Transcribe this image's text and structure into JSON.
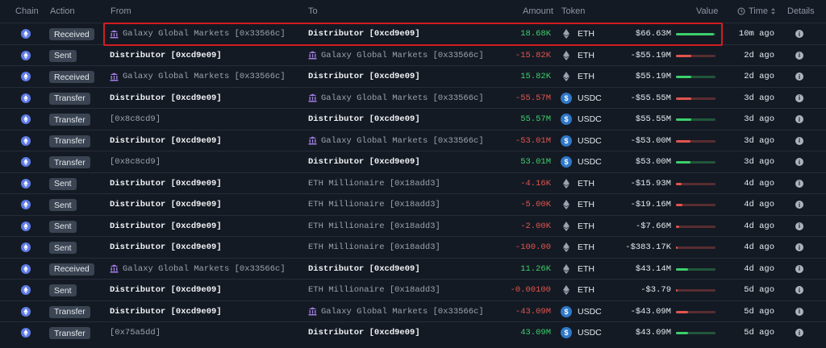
{
  "header": {
    "chain": "Chain",
    "action": "Action",
    "from": "From",
    "to": "To",
    "amount": "Amount",
    "token": "Token",
    "value": "Value",
    "time": "Time",
    "details": "Details"
  },
  "colors": {
    "positive": "#3ccf6c",
    "negative": "#e2544f",
    "highlight": "#d11d22",
    "chain": "#5f7be8",
    "usdc": "#2f78c9"
  },
  "rows": [
    {
      "action": "Received",
      "from": "Galaxy Global Markets [0x33566c]",
      "from_entity": true,
      "from_bright": false,
      "to": "Distributor [0xcd9e09]",
      "to_entity": false,
      "to_bright": true,
      "amount": "18.68K",
      "sign": "pos",
      "token": "ETH",
      "value": "$66.63M",
      "bar": 0.95,
      "time": "10m ago"
    },
    {
      "action": "Sent",
      "from": "Distributor [0xcd9e09]",
      "from_entity": false,
      "from_bright": true,
      "to": "Galaxy Global Markets [0x33566c]",
      "to_entity": true,
      "to_bright": false,
      "amount": "-15.82K",
      "sign": "neg",
      "token": "ETH",
      "value": "-$55.19M",
      "bar": 0.38,
      "time": "2d ago"
    },
    {
      "action": "Received",
      "from": "Galaxy Global Markets [0x33566c]",
      "from_entity": true,
      "from_bright": false,
      "to": "Distributor [0xcd9e09]",
      "to_entity": false,
      "to_bright": true,
      "amount": "15.82K",
      "sign": "pos",
      "token": "ETH",
      "value": "$55.19M",
      "bar": 0.38,
      "time": "2d ago"
    },
    {
      "action": "Transfer",
      "from": "Distributor [0xcd9e09]",
      "from_entity": false,
      "from_bright": true,
      "to": "Galaxy Global Markets [0x33566c]",
      "to_entity": true,
      "to_bright": false,
      "amount": "-55.57M",
      "sign": "neg",
      "token": "USDC",
      "value": "-$55.55M",
      "bar": 0.38,
      "time": "3d ago"
    },
    {
      "action": "Transfer",
      "from": "[0x8c8cd9]",
      "from_entity": false,
      "from_bright": false,
      "to": "Distributor [0xcd9e09]",
      "to_entity": false,
      "to_bright": true,
      "amount": "55.57M",
      "sign": "pos",
      "token": "USDC",
      "value": "$55.55M",
      "bar": 0.38,
      "time": "3d ago"
    },
    {
      "action": "Transfer",
      "from": "Distributor [0xcd9e09]",
      "from_entity": false,
      "from_bright": true,
      "to": "Galaxy Global Markets [0x33566c]",
      "to_entity": true,
      "to_bright": false,
      "amount": "-53.01M",
      "sign": "neg",
      "token": "USDC",
      "value": "-$53.00M",
      "bar": 0.36,
      "time": "3d ago"
    },
    {
      "action": "Transfer",
      "from": "[0x8c8cd9]",
      "from_entity": false,
      "from_bright": false,
      "to": "Distributor [0xcd9e09]",
      "to_entity": false,
      "to_bright": true,
      "amount": "53.01M",
      "sign": "pos",
      "token": "USDC",
      "value": "$53.00M",
      "bar": 0.36,
      "time": "3d ago"
    },
    {
      "action": "Sent",
      "from": "Distributor [0xcd9e09]",
      "from_entity": false,
      "from_bright": true,
      "to": "ETH Millionaire [0x18add3]",
      "to_entity": false,
      "to_bright": false,
      "amount": "-4.16K",
      "sign": "neg",
      "token": "ETH",
      "value": "-$15.93M",
      "bar": 0.14,
      "time": "4d ago"
    },
    {
      "action": "Sent",
      "from": "Distributor [0xcd9e09]",
      "from_entity": false,
      "from_bright": true,
      "to": "ETH Millionaire [0x18add3]",
      "to_entity": false,
      "to_bright": false,
      "amount": "-5.00K",
      "sign": "neg",
      "token": "ETH",
      "value": "-$19.16M",
      "bar": 0.16,
      "time": "4d ago"
    },
    {
      "action": "Sent",
      "from": "Distributor [0xcd9e09]",
      "from_entity": false,
      "from_bright": true,
      "to": "ETH Millionaire [0x18add3]",
      "to_entity": false,
      "to_bright": false,
      "amount": "-2.00K",
      "sign": "neg",
      "token": "ETH",
      "value": "-$7.66M",
      "bar": 0.08,
      "time": "4d ago"
    },
    {
      "action": "Sent",
      "from": "Distributor [0xcd9e09]",
      "from_entity": false,
      "from_bright": true,
      "to": "ETH Millionaire [0x18add3]",
      "to_entity": false,
      "to_bright": false,
      "amount": "-100.00",
      "sign": "neg",
      "token": "ETH",
      "value": "-$383.17K",
      "bar": 0.03,
      "time": "4d ago"
    },
    {
      "action": "Received",
      "from": "Galaxy Global Markets [0x33566c]",
      "from_entity": true,
      "from_bright": false,
      "to": "Distributor [0xcd9e09]",
      "to_entity": false,
      "to_bright": true,
      "amount": "11.26K",
      "sign": "pos",
      "token": "ETH",
      "value": "$43.14M",
      "bar": 0.3,
      "time": "4d ago"
    },
    {
      "action": "Sent",
      "from": "Distributor [0xcd9e09]",
      "from_entity": false,
      "from_bright": true,
      "to": "ETH Millionaire [0x18add3]",
      "to_entity": false,
      "to_bright": false,
      "amount": "-0.00100",
      "sign": "neg",
      "token": "ETH",
      "value": "-$3.79",
      "bar": 0.01,
      "time": "5d ago"
    },
    {
      "action": "Transfer",
      "from": "Distributor [0xcd9e09]",
      "from_entity": false,
      "from_bright": true,
      "to": "Galaxy Global Markets [0x33566c]",
      "to_entity": true,
      "to_bright": false,
      "amount": "-43.09M",
      "sign": "neg",
      "token": "USDC",
      "value": "-$43.09M",
      "bar": 0.3,
      "time": "5d ago"
    },
    {
      "action": "Transfer",
      "from": "[0x75a5dd]",
      "from_entity": false,
      "from_bright": false,
      "to": "Distributor [0xcd9e09]",
      "to_entity": false,
      "to_bright": true,
      "amount": "43.09M",
      "sign": "pos",
      "token": "USDC",
      "value": "$43.09M",
      "bar": 0.3,
      "time": "5d ago"
    }
  ]
}
